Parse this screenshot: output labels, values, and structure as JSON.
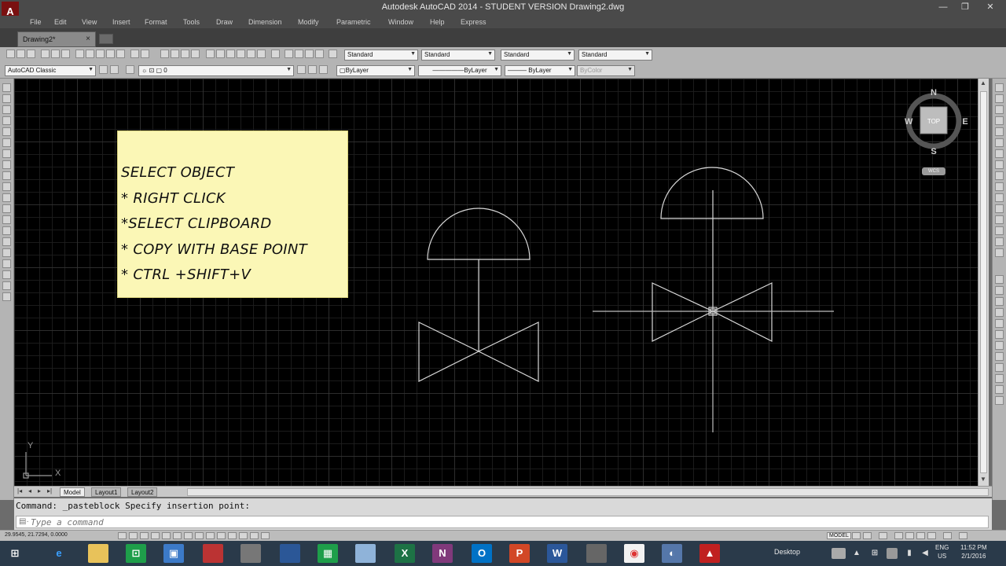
{
  "window": {
    "title": "Autodesk AutoCAD 2014 - STUDENT VERSION    Drawing2.dwg",
    "logo": "A"
  },
  "menu": [
    "File",
    "Edit",
    "View",
    "Insert",
    "Format",
    "Tools",
    "Draw",
    "Dimension",
    "Modify",
    "Parametric",
    "Window",
    "Help",
    "Express"
  ],
  "document_tab": {
    "label": "Drawing2*",
    "close": "×"
  },
  "toolbar": {
    "text_style": "Standard",
    "dim_style": "Standard",
    "table_style": "Standard",
    "mleader_style": "Standard",
    "workspace": "AutoCAD Classic",
    "layer": "0",
    "color": "ByLayer",
    "linetype": "ByLayer",
    "lineweight": "ByLayer",
    "plotstyle": "ByColor"
  },
  "note": {
    "lines": [
      "SELECT OBJECT",
      "* RIGHT CLICK",
      "*SELECT CLIPBOARD",
      "* COPY WITH BASE  POINT",
      "* CTRL +SHIFT+V"
    ]
  },
  "viewcube": {
    "north": "N",
    "south": "S",
    "east": "E",
    "west": "W",
    "face": "TOP",
    "wcs": "WCS"
  },
  "ucs": {
    "y": "Y",
    "x": "X"
  },
  "layout_tabs": [
    "Model",
    "Layout1",
    "Layout2"
  ],
  "command": {
    "history": "Command: _pasteblock Specify insertion point:",
    "placeholder": "Type a command"
  },
  "status": {
    "coords": "29.9545, 21.7294, 0.0000",
    "model": "MODEL"
  },
  "taskbar": {
    "desktop": "Desktop",
    "lang_top": "ENG",
    "lang_bottom": "US",
    "time": "11:52 PM",
    "date": "2/1/2016"
  },
  "colors": {
    "canvas": "#000000",
    "drawing_lines": "#d8d8d8",
    "note_bg": "#fbf7b6",
    "taskbar": "#2a3a4a"
  }
}
